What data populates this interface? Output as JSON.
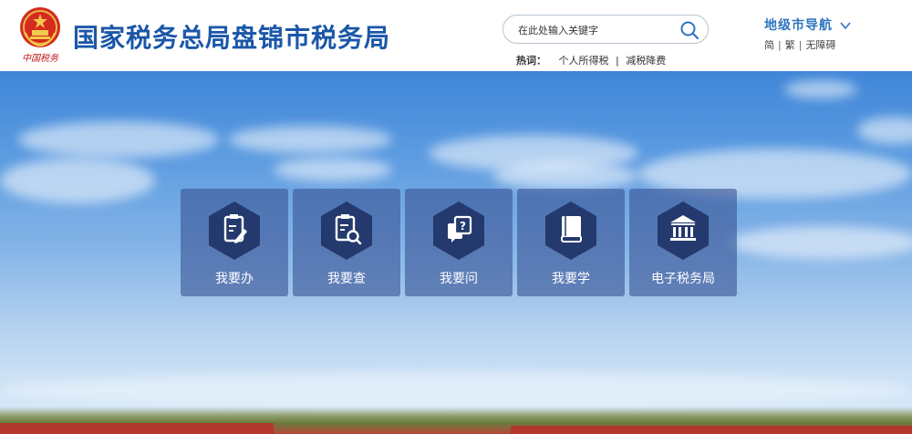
{
  "header": {
    "logo_caption": "中国税务",
    "site_title": "国家税务总局盘锦市税务局",
    "search": {
      "placeholder": "在此处输入关键字"
    },
    "hotwords": {
      "label": "热词：",
      "items": [
        "个人所得税",
        "减税降费"
      ],
      "separator": "|"
    },
    "regional_nav": {
      "label": "地级市导航"
    },
    "lang_links": {
      "simplified": "简",
      "traditional": "繁",
      "accessible": "无障碍",
      "separator": "|"
    }
  },
  "services": [
    {
      "label": "我要办",
      "icon": "document-edit-icon"
    },
    {
      "label": "我要查",
      "icon": "document-search-icon"
    },
    {
      "label": "我要问",
      "icon": "question-chat-icon"
    },
    {
      "label": "我要学",
      "icon": "book-icon"
    },
    {
      "label": "电子税务局",
      "icon": "bank-building-icon"
    }
  ],
  "colors": {
    "title_blue": "#1b57a8",
    "nav_blue": "#2f74c0",
    "hexagon_navy": "#24396d",
    "tile_bg": "rgba(58, 86, 150, 0.62)",
    "logo_red": "#c4161c"
  }
}
